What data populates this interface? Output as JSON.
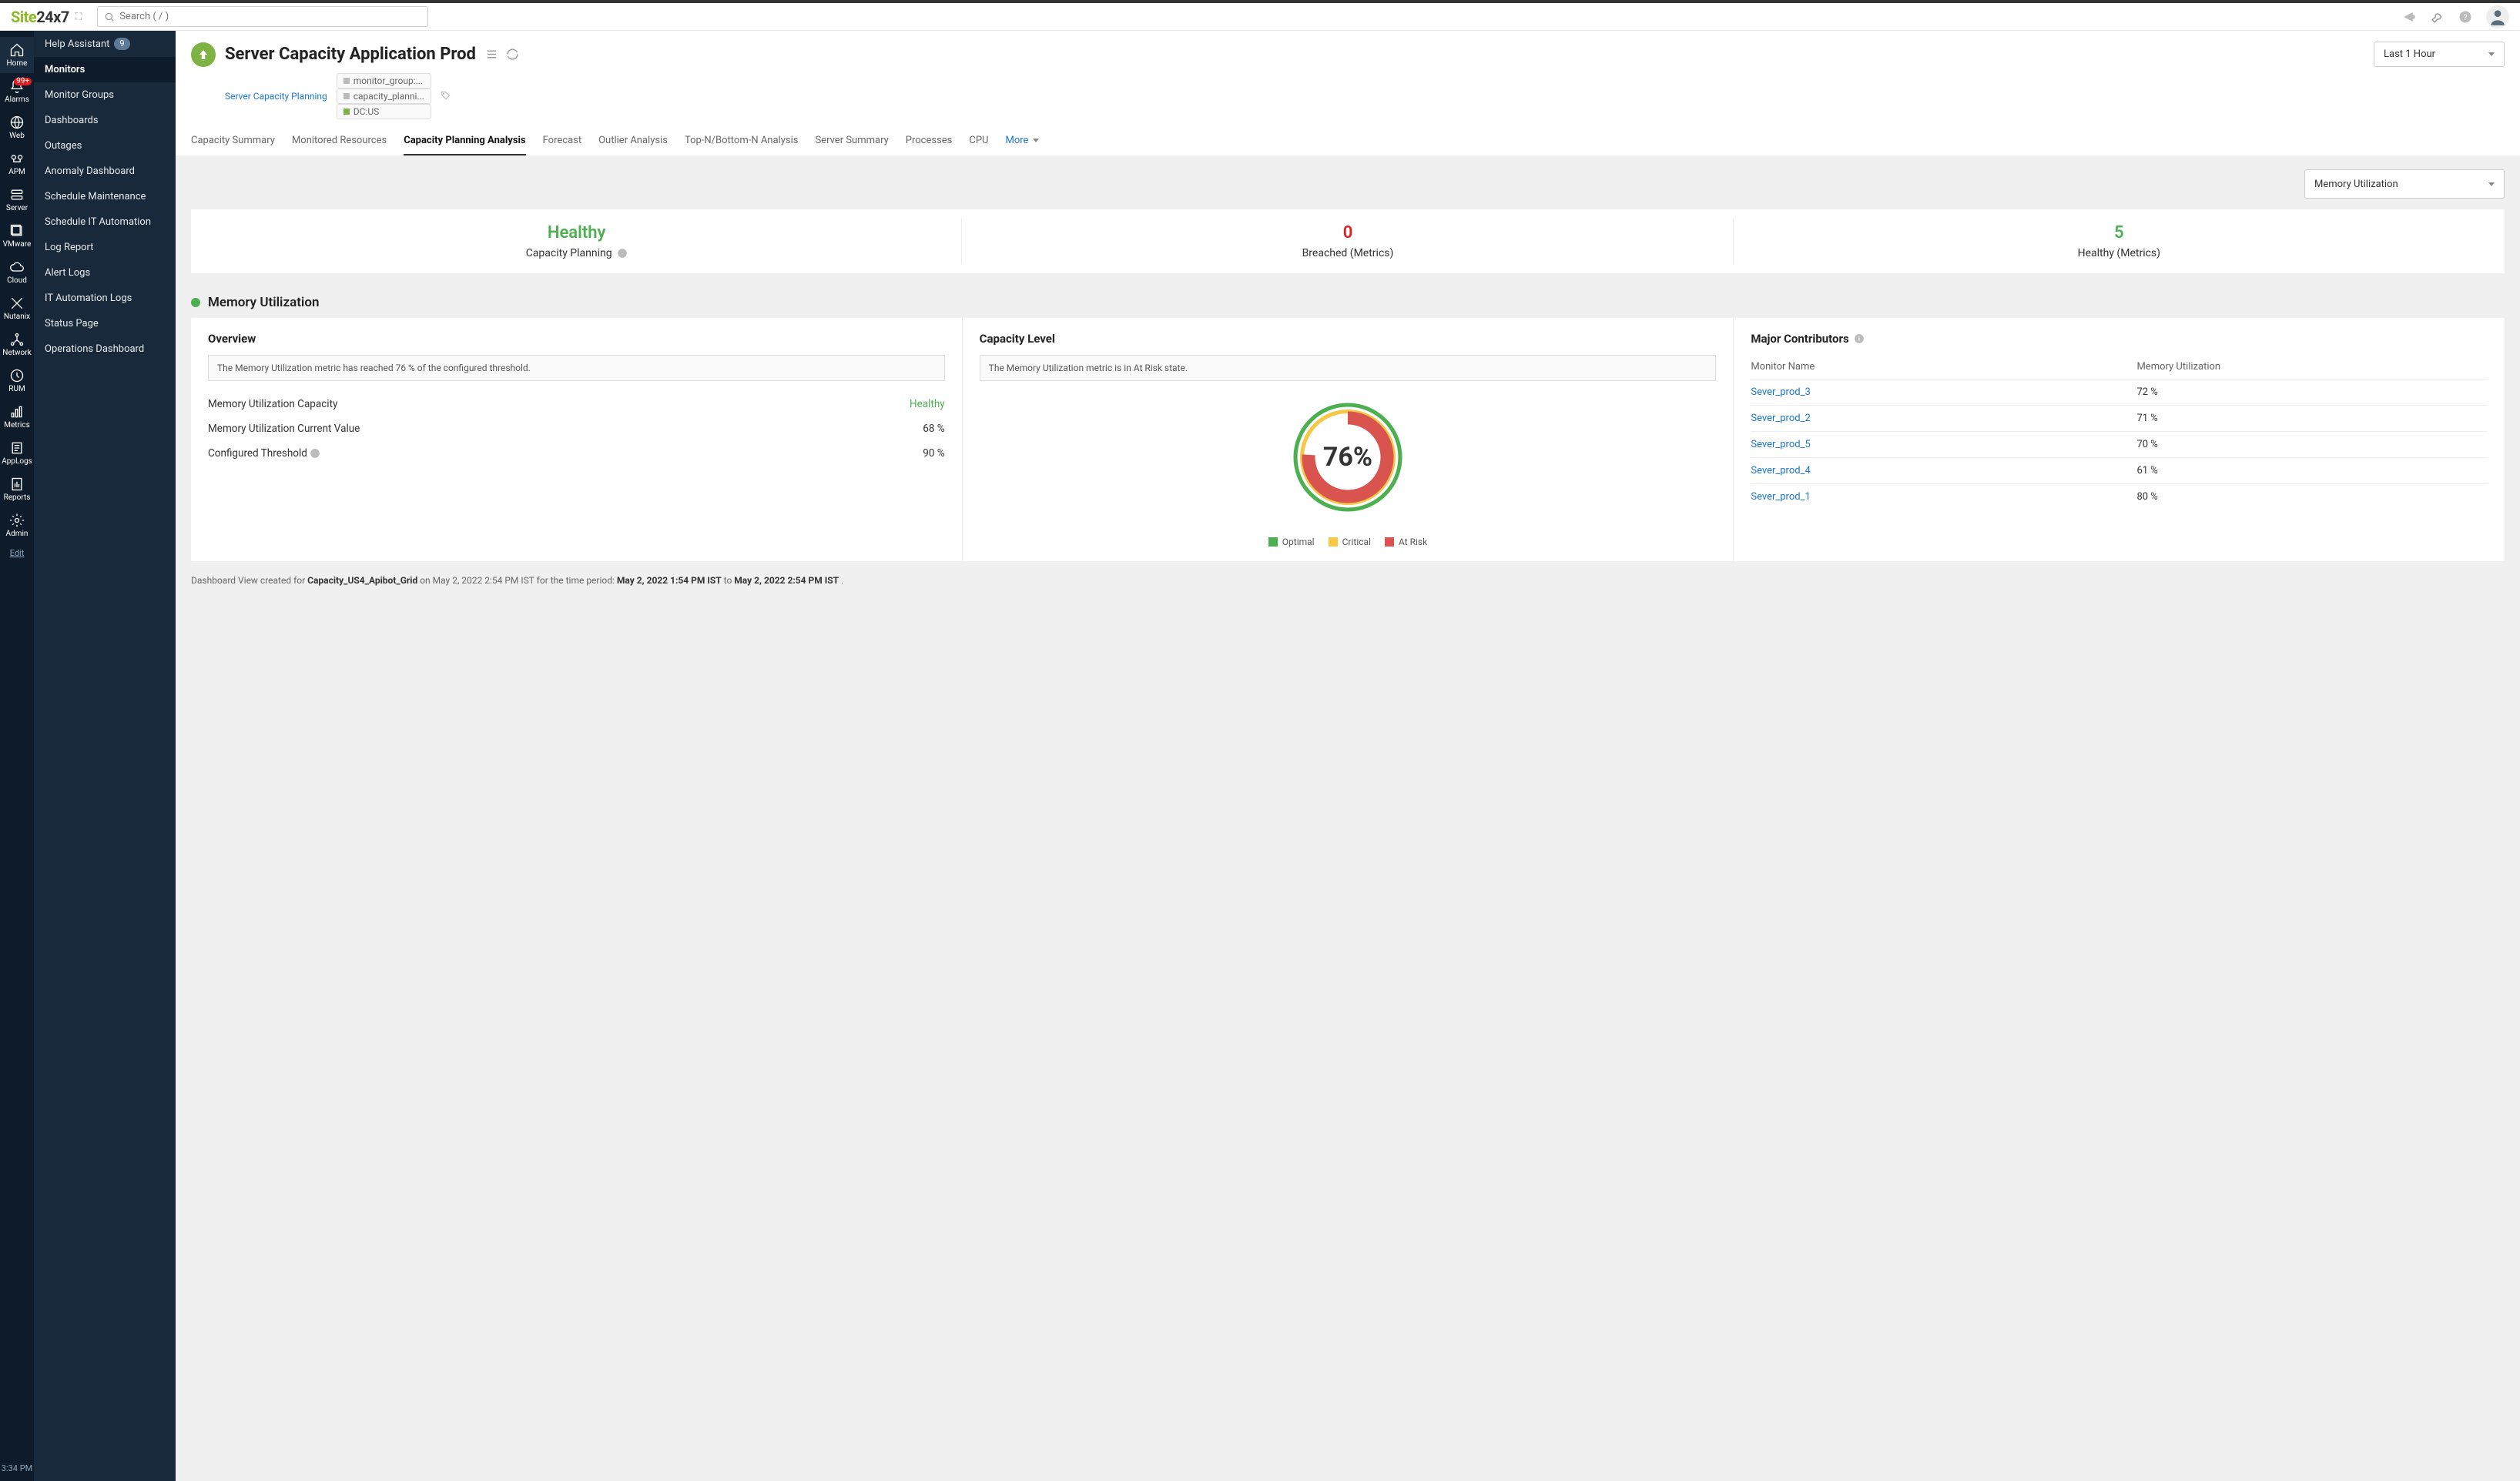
{
  "logo": {
    "part1": "Site",
    "part2": "24x7"
  },
  "search": {
    "placeholder": "Search ( / )"
  },
  "iconbar": {
    "items": [
      {
        "label": "Home"
      },
      {
        "label": "Alarms",
        "badge": "99+"
      },
      {
        "label": "Web"
      },
      {
        "label": "APM"
      },
      {
        "label": "Server"
      },
      {
        "label": "VMware"
      },
      {
        "label": "Cloud"
      },
      {
        "label": "Nutanix"
      },
      {
        "label": "Network"
      },
      {
        "label": "RUM"
      },
      {
        "label": "Metrics"
      },
      {
        "label": "AppLogs"
      },
      {
        "label": "Reports"
      },
      {
        "label": "Admin"
      }
    ],
    "edit": "Edit",
    "time": "3:34 PM"
  },
  "submenu": [
    {
      "label": "Help Assistant",
      "pill": "9"
    },
    {
      "label": "Monitors",
      "active": true
    },
    {
      "label": "Monitor Groups"
    },
    {
      "label": "Dashboards"
    },
    {
      "label": "Outages"
    },
    {
      "label": "Anomaly Dashboard"
    },
    {
      "label": "Schedule Maintenance"
    },
    {
      "label": "Schedule IT Automation"
    },
    {
      "label": "Log Report"
    },
    {
      "label": "Alert Logs"
    },
    {
      "label": "IT Automation Logs"
    },
    {
      "label": "Status Page"
    },
    {
      "label": "Operations Dashboard"
    }
  ],
  "page": {
    "title": "Server Capacity Application Prod",
    "breadcrumb": "Server Capacity Planning",
    "tags": [
      {
        "text": "monitor_group:..."
      },
      {
        "text": "capacity_planni..."
      },
      {
        "text": "DC:US",
        "green": true
      }
    ],
    "timeRange": "Last 1 Hour"
  },
  "tabs": [
    "Capacity Summary",
    "Monitored Resources",
    "Capacity Planning Analysis",
    "Forecast",
    "Outlier Analysis",
    "Top-N/Bottom-N Analysis",
    "Server Summary",
    "Processes",
    "CPU"
  ],
  "tabsActive": 2,
  "more": "More",
  "metricSelect": "Memory Utilization",
  "summary": [
    {
      "big": "Healthy",
      "label": "Capacity Planning",
      "color": "green",
      "info": true
    },
    {
      "big": "0",
      "label": "Breached (Metrics)",
      "color": "red"
    },
    {
      "big": "5",
      "label": "Healthy (Metrics)",
      "color": "green"
    }
  ],
  "section": {
    "title": "Memory Utilization",
    "overview": {
      "heading": "Overview",
      "msg": "The Memory Utilization metric has reached 76 % of the configured threshold.",
      "rows": [
        {
          "k": "Memory Utilization Capacity",
          "v": "Healthy",
          "green": true
        },
        {
          "k": "Memory Utilization Current Value",
          "v": "68 %"
        },
        {
          "k": "Configured Threshold",
          "v": "90 %",
          "info": true
        }
      ]
    },
    "capacity": {
      "heading": "Capacity Level",
      "msg": "The Memory Utilization metric is in At Risk state.",
      "gauge": "76%",
      "legend": [
        {
          "label": "Optimal",
          "color": "#4caf50"
        },
        {
          "label": "Critical",
          "color": "#f7c846"
        },
        {
          "label": "At Risk",
          "color": "#d9534f"
        }
      ]
    },
    "contributors": {
      "heading": "Major Contributors",
      "cols": [
        "Monitor Name",
        "Memory Utilization"
      ],
      "rows": [
        {
          "name": "Sever_prod_3",
          "val": "72 %"
        },
        {
          "name": "Sever_prod_2",
          "val": "71 %"
        },
        {
          "name": "Sever_prod_5",
          "val": "70 %"
        },
        {
          "name": "Sever_prod_4",
          "val": "61 %"
        },
        {
          "name": "Sever_prod_1",
          "val": "80 %"
        }
      ]
    }
  },
  "footer": {
    "pre": "Dashboard View created for ",
    "bold1": "Capacity_US4_Apibot_Grid",
    "mid": " on May 2, 2022 2:54 PM IST for the time period: ",
    "bold2": "May 2, 2022 1:54 PM IST",
    "to": " to ",
    "bold3": "May 2, 2022 2:54 PM IST",
    "end": " ."
  },
  "chart_data": {
    "type": "pie",
    "title": "Memory Utilization Capacity Level",
    "value": 76,
    "unit": "%",
    "legend": [
      "Optimal",
      "Critical",
      "At Risk"
    ],
    "colors": {
      "Optimal": "#4caf50",
      "Critical": "#f7c846",
      "At Risk": "#d9534f"
    },
    "state": "At Risk"
  }
}
